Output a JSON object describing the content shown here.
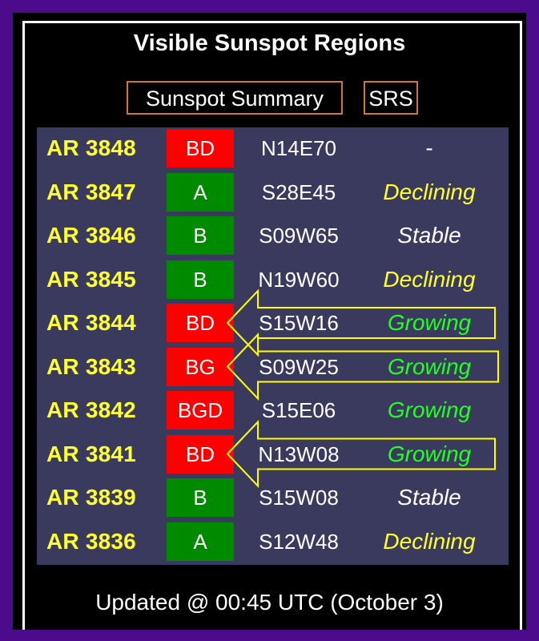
{
  "title": "Visible Sunspot Regions",
  "buttons": {
    "summary": "Sunspot Summary",
    "srs": "SRS"
  },
  "colors": {
    "red": "#ff0000",
    "green": "#008a00",
    "yellow": "#ffff2e",
    "bright_green": "#22ff22",
    "white": "#ffffff",
    "arrow": "#ffff00"
  },
  "regions": [
    {
      "region": "AR 3848",
      "mag": "BD",
      "mag_color": "red",
      "location": "N14E70",
      "trend": "-",
      "trend_color": "white"
    },
    {
      "region": "AR 3847",
      "mag": "A",
      "mag_color": "green",
      "location": "S28E45",
      "trend": "Declining",
      "trend_color": "yellow"
    },
    {
      "region": "AR 3846",
      "mag": "B",
      "mag_color": "green",
      "location": "S09W65",
      "trend": "Stable",
      "trend_color": "white"
    },
    {
      "region": "AR 3845",
      "mag": "B",
      "mag_color": "green",
      "location": "N19W60",
      "trend": "Declining",
      "trend_color": "yellow"
    },
    {
      "region": "AR 3844",
      "mag": "BD",
      "mag_color": "red",
      "location": "S15W16",
      "trend": "Growing",
      "trend_color": "bright_green",
      "highlighted": true
    },
    {
      "region": "AR 3843",
      "mag": "BG",
      "mag_color": "red",
      "location": "S09W25",
      "trend": "Growing",
      "trend_color": "bright_green",
      "highlighted": true
    },
    {
      "region": "AR 3842",
      "mag": "BGD",
      "mag_color": "red",
      "location": "S15E06",
      "trend": "Growing",
      "trend_color": "bright_green"
    },
    {
      "region": "AR 3841",
      "mag": "BD",
      "mag_color": "red",
      "location": "N13W08",
      "trend": "Growing",
      "trend_color": "bright_green",
      "highlighted": true
    },
    {
      "region": "AR 3839",
      "mag": "B",
      "mag_color": "green",
      "location": "S15W08",
      "trend": "Stable",
      "trend_color": "white"
    },
    {
      "region": "AR 3836",
      "mag": "A",
      "mag_color": "green",
      "location": "S12W48",
      "trend": "Declining",
      "trend_color": "yellow"
    }
  ],
  "footer": "Updated @ 00:45 UTC (October 3)"
}
